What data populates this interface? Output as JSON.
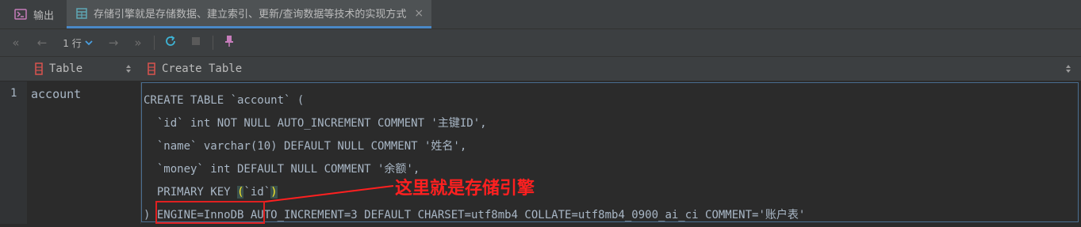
{
  "tabs": {
    "output": {
      "label": "输出",
      "icon": "console-icon"
    },
    "table": {
      "label": "存储引擎就是存储数据、建立索引、更新/查询数据等技术的实现方式",
      "icon": "table-grid-icon",
      "close": "×"
    }
  },
  "toolbar": {
    "first": "«",
    "prev": "←",
    "rows": "1 行",
    "next": "→",
    "last": "»",
    "refresh_icon": "refresh-icon",
    "stop_icon": "stop-icon",
    "pin_icon": "pin-icon"
  },
  "columns": {
    "col1": {
      "label": "Table"
    },
    "col2": {
      "label": "Create Table"
    }
  },
  "rows": [
    {
      "num": "1",
      "table": "account"
    }
  ],
  "code": {
    "line1": "CREATE TABLE `account` (",
    "line2": "  `id` int NOT NULL AUTO_INCREMENT COMMENT '主键ID',",
    "line3": "  `name` varchar(10) DEFAULT NULL COMMENT '姓名',",
    "line4": "  `money` int DEFAULT NULL COMMENT '余额',",
    "line5_pre": "  PRIMARY KEY ",
    "line5_open": "(",
    "line5_mid": "`id`",
    "line5_close": ")",
    "line6": ") ENGINE=InnoDB AUTO_INCREMENT=3 DEFAULT CHARSET=utf8mb4 COLLATE=utf8mb4_0900_ai_ci COMMENT='账户表'"
  },
  "annotation": "这里就是存储引擎",
  "colors": {
    "accent": "#4a88c7",
    "annotation": "#ff2020"
  }
}
